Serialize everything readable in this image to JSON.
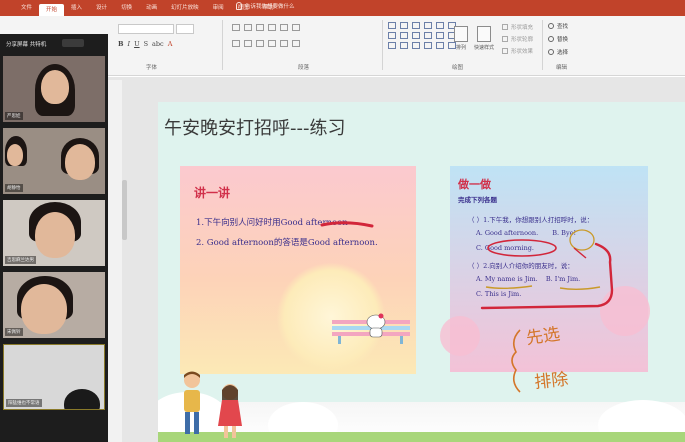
{
  "ribbon": {
    "tabs": [
      "文件",
      "开始",
      "插入",
      "设计",
      "切换",
      "动画",
      "幻灯片放映",
      "审阅",
      "视图",
      "帮助"
    ],
    "active_tab": "开始",
    "tell_me": "告诉我你想要做什么",
    "groups": {
      "font": "字体",
      "paragraph": "段落",
      "drawing": "绘图",
      "editing": "编辑"
    },
    "font_format_letters": [
      "B",
      "I",
      "U",
      "S",
      "abc",
      "A"
    ],
    "drawing_buttons": [
      "排列",
      "快速样式"
    ],
    "drawing_side": [
      "形状填充",
      "形状轮廓",
      "形状效果"
    ],
    "editing_items": [
      "查找",
      "替换",
      "选择"
    ],
    "accent_color": "#c1432a"
  },
  "meeting": {
    "header_text": "分享屏幕  共特机",
    "participants": [
      {
        "name": "严思娃",
        "tile": "participant-1"
      },
      {
        "name": "胡静怡",
        "tile": "participant-2"
      },
      {
        "name": "吉思麻兰达男",
        "tile": "participant-3"
      },
      {
        "name": "宋佩铃",
        "tile": "participant-4"
      },
      {
        "name": "阳猛维也不常语",
        "tile": "participant-5"
      }
    ]
  },
  "slide": {
    "title": "午安晚安打招呼---练习",
    "left_panel": {
      "heading": "讲一讲",
      "line1": "1.下午向别人问好时用Good afternoon",
      "line2": "2. Good afternoon的答语是Good afternoon."
    },
    "right_panel": {
      "heading": "做一做",
      "subheading": "完成下列各题",
      "q1": "（  ）1.下午我，你想跟别人打招呼时，说：",
      "q1_options": [
        "A. Good afternoon.",
        "B. Bye!"
      ],
      "q1_option_c": "C. Good morning.",
      "q2": "（  ）2.向别人介绍你的朋友时，说：",
      "q2_options": [
        "A. My name is Jim.",
        "B. I'm Jim."
      ],
      "q2_option_c": "C. This is Jim."
    },
    "handwriting": [
      "先选",
      "排除"
    ]
  }
}
